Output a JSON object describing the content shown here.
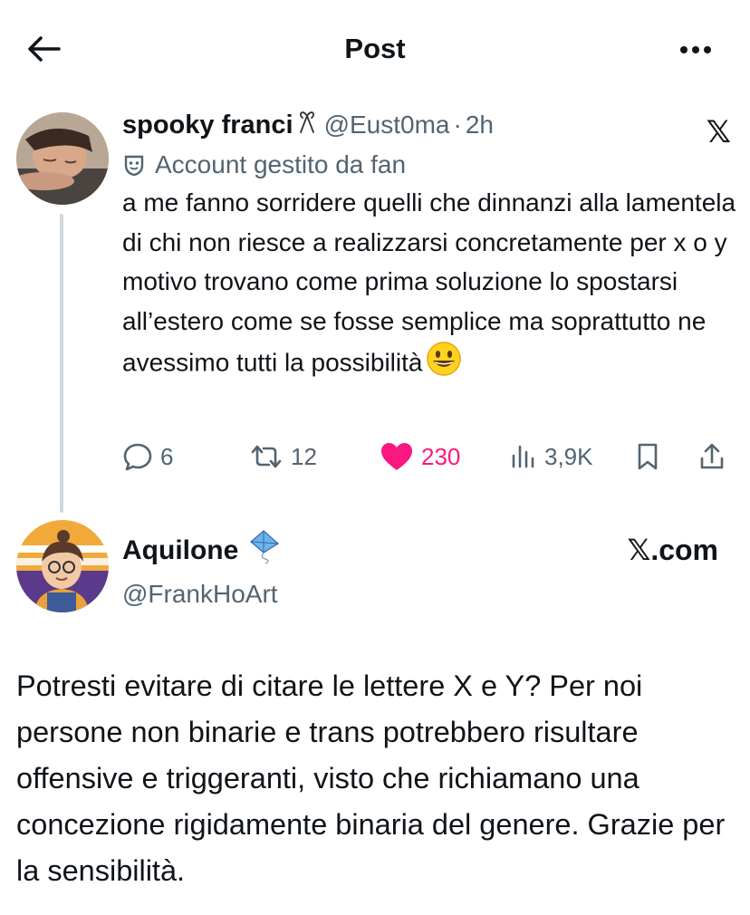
{
  "header": {
    "title": "Post"
  },
  "icons": {
    "back": "arrow-left-icon",
    "more": "more-horizontal-icon",
    "x_logo": "x-logo-icon",
    "fan": "mask-icon",
    "reply": "comment-icon",
    "repost": "repost-icon",
    "like": "heart-icon",
    "views": "bar-chart-icon",
    "bookmark": "bookmark-icon",
    "share": "share-icon"
  },
  "colors": {
    "like": "#f91880",
    "secondary_text": "#536471",
    "thread_line": "#cfd9de"
  },
  "post": {
    "display_name": "spooky franci",
    "name_emoji": "🎀",
    "handle": "@Eust0ma",
    "separator": "·",
    "time": "2h",
    "x_logo": "𝕏",
    "fan_label": "Account gestito da fan",
    "text": "a me fanno sorridere quelli che dinnanzi alla lamentela di chi non riesce a realizzarsi concretamente per x o y motivo trovano come prima soluzione lo spostarsi all’estero come se fosse semplice ma soprattutto ne avessimo tutti la possibilità",
    "stats": {
      "replies": "6",
      "reposts": "12",
      "likes": "230",
      "views": "3,9K"
    }
  },
  "reply": {
    "display_name": "Aquilone",
    "handle": "@FrankHoArt",
    "source": "𝕏.com",
    "text": "Potresti evitare di citare le lettere X e Y? Per noi persone non binarie e trans potrebbero risultare offensive e triggeranti, visto che richiamano una concezione rigidamente binaria del genere. Grazie per la sensibilità."
  }
}
